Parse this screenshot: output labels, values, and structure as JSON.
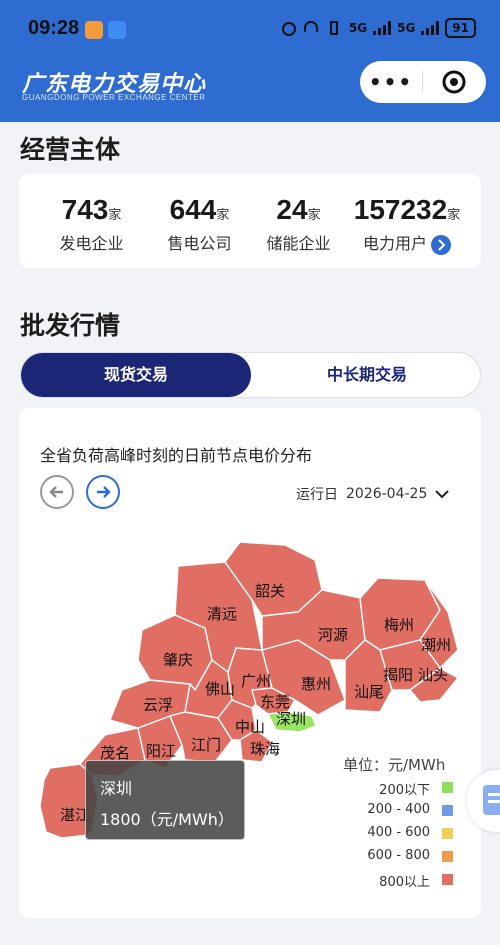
{
  "status_bar": {
    "time": "09:28",
    "network1": "5G",
    "network2": "5G",
    "battery": "91"
  },
  "header": {
    "logo_cn": "广东电力交易中心",
    "logo_en": "GUANGDONG POWER EXCHANGE CENTER"
  },
  "entities": {
    "title": "经营主体",
    "items": [
      {
        "value": "743",
        "unit": "家",
        "label": "发电企业"
      },
      {
        "value": "644",
        "unit": "家",
        "label": "售电公司"
      },
      {
        "value": "24",
        "unit": "家",
        "label": "储能企业"
      },
      {
        "value": "157232",
        "unit": "家",
        "label": "电力用户"
      }
    ]
  },
  "wholesale": {
    "title": "批发行情",
    "tabs": [
      {
        "label": "现货交易",
        "active": true
      },
      {
        "label": "中长期交易",
        "active": false
      }
    ]
  },
  "map_panel": {
    "title": "全省负荷高峰时刻的日前节点电价分布",
    "date_label": "运行日",
    "date": "2026-04-25",
    "regions": [
      "韶关",
      "清远",
      "河源",
      "梅州",
      "潮州",
      "肇庆",
      "广州",
      "惠州",
      "揭阳",
      "汕头",
      "佛山",
      "东莞",
      "云浮",
      "汕尾",
      "深圳",
      "中山",
      "茂名",
      "阳江",
      "江门",
      "珠海",
      "湛江"
    ],
    "tooltip": {
      "city": "深圳",
      "value": "1800（元/MWh）"
    },
    "legend": {
      "title": "单位：元/MWh",
      "items": [
        {
          "label": "200以下",
          "color": "#8de05a"
        },
        {
          "label": "200 - 400",
          "color": "#6f9ae6"
        },
        {
          "label": "400 - 600",
          "color": "#f1cf58"
        },
        {
          "label": "600 - 800",
          "color": "#ee9b4a"
        },
        {
          "label": "800以上",
          "color": "#e06e63"
        }
      ]
    },
    "colors": {
      "high": "#e06e63",
      "low": "#9be463"
    }
  }
}
